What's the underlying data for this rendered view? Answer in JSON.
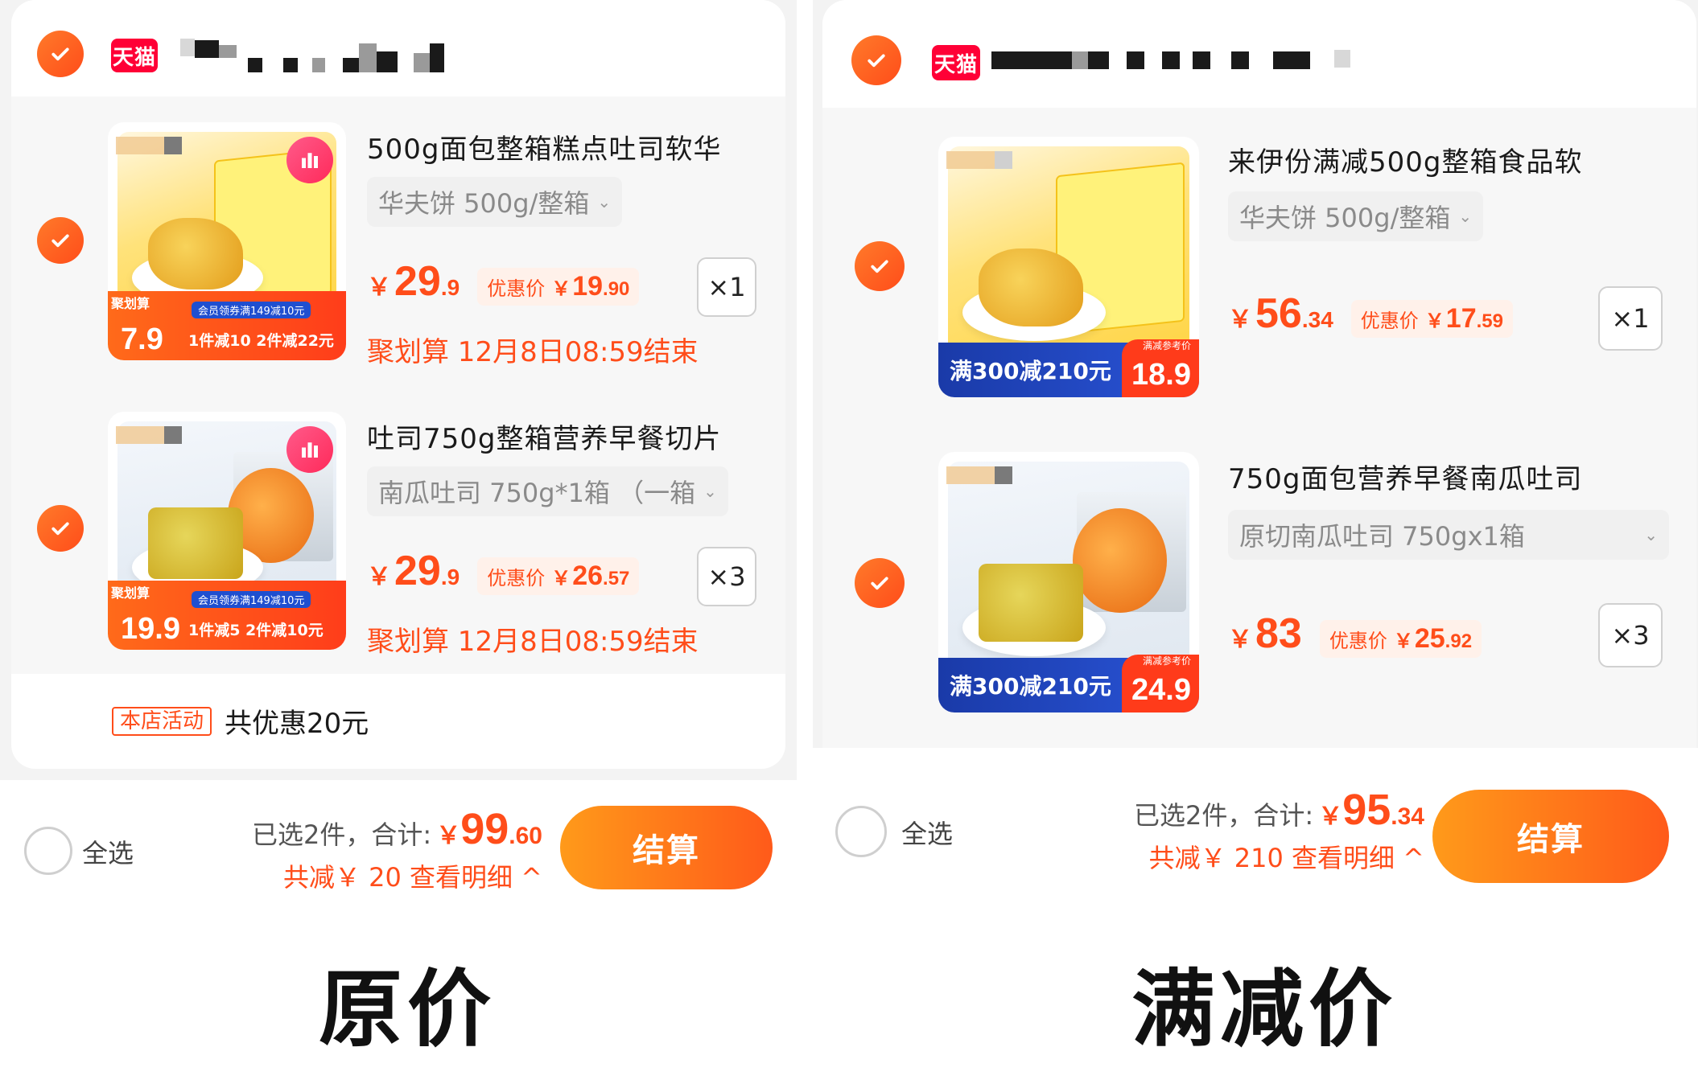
{
  "store": {
    "tmall_label": "天猫"
  },
  "left": {
    "items": [
      {
        "title": "500g面包整箱糕点吐司软华",
        "sku": "华夫饼 500g/整箱",
        "price_int": "29",
        "price_dec": ".9",
        "disc_label": "优惠价",
        "disc_int": "19",
        "disc_dec": ".90",
        "qty": "×1",
        "deal": "聚划算 12月8日08:59结束",
        "thumb": {
          "jhs": "聚划算",
          "big": "7.9",
          "promo1": "会员领券满149减10元",
          "promo2": "1件减10 2件减22元"
        }
      },
      {
        "title": "吐司750g整箱营养早餐切片",
        "sku": "南瓜吐司 750g*1箱 （一箱",
        "price_int": "29",
        "price_dec": ".9",
        "disc_label": "优惠价",
        "disc_int": "26",
        "disc_dec": ".57",
        "qty": "×3",
        "deal": "聚划算 12月8日08:59结束",
        "thumb": {
          "jhs": "聚划算",
          "big": "19.9",
          "promo1": "会员领券满149减10元",
          "promo2": "1件减5 2件减10元"
        }
      }
    ],
    "promo_tag": "本店活动",
    "promo_text": "共优惠20元",
    "footer": {
      "select_all": "全选",
      "selected": "已选2件，合计:",
      "total_int": "99",
      "total_dec": ".60",
      "saved": "共减￥ 20 查看明细 ^",
      "pay": "结算"
    },
    "caption": "原价"
  },
  "right": {
    "items": [
      {
        "title": "来伊份满减500g整箱食品软",
        "sku": "华夫饼 500g/整箱",
        "price_int": "56",
        "price_dec": ".34",
        "disc_label": "优惠价",
        "disc_int": "17",
        "disc_dec": ".59",
        "qty": "×1",
        "thumb": {
          "full": "满300减210元",
          "ref": "满减参考价",
          "price": "18.9"
        }
      },
      {
        "title": "750g面包营养早餐南瓜吐司",
        "sku": "原切南瓜吐司 750gx1箱",
        "price_int": "83",
        "price_dec": "",
        "disc_label": "优惠价",
        "disc_int": "25",
        "disc_dec": ".92",
        "qty": "×3",
        "thumb": {
          "full": "满300减210元",
          "ref": "满减参考价",
          "price": "24.9"
        }
      }
    ],
    "footer": {
      "select_all": "全选",
      "selected": "已选2件，合计:",
      "total_int": "95",
      "total_dec": ".34",
      "saved": "共减￥ 210 查看明细 ^",
      "pay": "结算"
    },
    "caption": "满减价"
  },
  "currency": "￥",
  "colors": {
    "accent": "#ff4d1a",
    "pay_start": "#ff9a1a",
    "pay_end": "#ff5a1a",
    "tmall": "#ff0036"
  }
}
